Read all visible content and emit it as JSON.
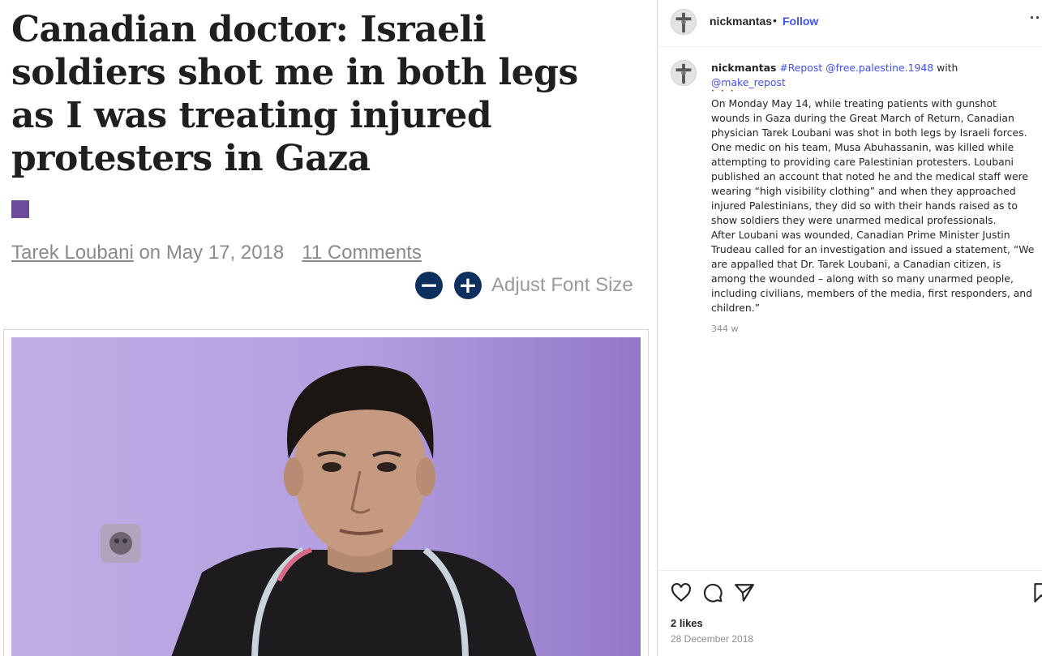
{
  "article": {
    "headline": "Canadian doctor: Israeli soldiers shot me in both legs as I was treating injured protesters in Gaza",
    "author": "Tarek Loubani",
    "date_prefix": " on ",
    "date": "May 17, 2018",
    "comments": "11 Comments",
    "font_minus": "−",
    "font_plus": "+",
    "font_label": "Adjust Font Size"
  },
  "post": {
    "username": "nickmantas",
    "dot": "•",
    "follow": "Follow",
    "more": "···",
    "caption": {
      "username": "nickmantas",
      "hashtag": "#Repost",
      "mention1": "@free.palestine.1948",
      "with": "with",
      "mention2": "@make_repost",
      "dots": "· · ·",
      "paragraph1": "On Monday May 14, while treating patients with gunshot wounds in Gaza during the Great March of Return, Canadian physician Tarek Loubani was shot in both legs by Israeli forces. One medic on his team, Musa Abuhassanin, was killed while attempting to providing care Palestinian protesters. Loubani published an account that noted he and the medical staff were wearing “high visibility clothing” and when they approached injured Palestinians, they did so with their hands raised as to show soldiers they were unarmed medical professionals.",
      "paragraph2": "After Loubani was wounded, Canadian Prime Minister Justin Trudeau called for an investigation and issued a statement, “We are appalled that Dr. Tarek Loubani, a Canadian citizen, is among the wounded – along with so many unarmed people, including civilians, members of the media, first responders, and children.”",
      "time": "344 w"
    },
    "likes": "2 likes",
    "date": "28 December 2018"
  },
  "colors": {
    "accent_link": "#4150f7",
    "category": "#6b4c9a",
    "font_button": "#0d2f5e"
  },
  "icons": [
    "heart-icon",
    "comment-icon",
    "share-icon",
    "bookmark-icon",
    "crucifix-avatar",
    "more-icon"
  ]
}
